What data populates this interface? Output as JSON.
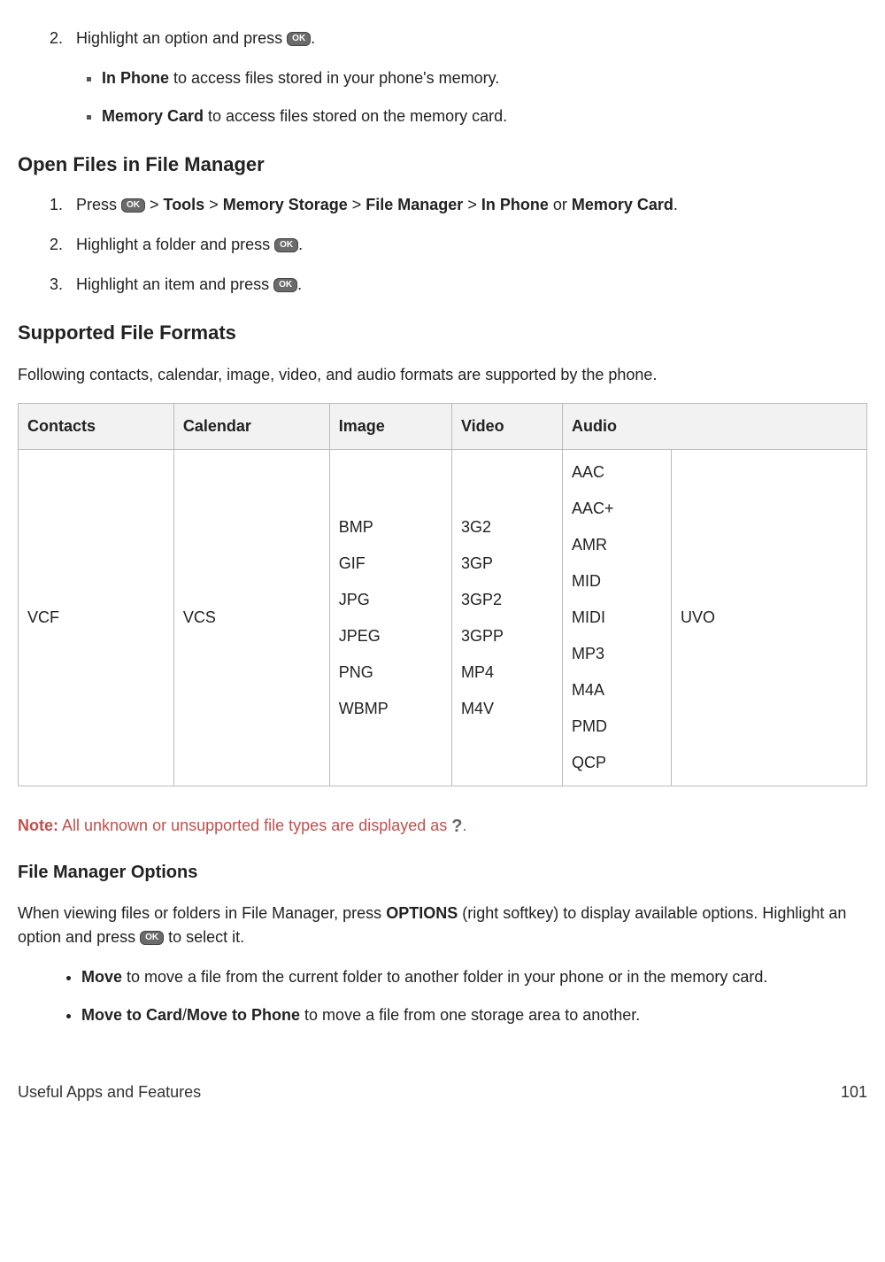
{
  "intro": {
    "step2_num": "2.",
    "step2_text_a": "Highlight an option and press ",
    "step2_text_b": ".",
    "bullets": [
      {
        "bold": "In Phone",
        "rest": " to access files stored in your phone's memory."
      },
      {
        "bold": "Memory Card",
        "rest": " to access files stored on the memory card."
      }
    ]
  },
  "open_files": {
    "heading": "Open Files in File Manager",
    "steps": [
      {
        "pre": "Press ",
        "after": " > ",
        "b1": "Tools",
        "s1": " > ",
        "b2": "Memory Storage",
        "s2": " > ",
        "b3": "File Manager",
        "s3": " > ",
        "b4": "In Phone",
        "s4": " or ",
        "b5": "Memory Card",
        "end": "."
      },
      {
        "text_a": "Highlight a folder and press ",
        "text_b": "."
      },
      {
        "text_a": "Highlight an item and press ",
        "text_b": "."
      }
    ]
  },
  "formats": {
    "heading": "Supported File Formats",
    "intro": "Following contacts, calendar, image, video, and audio formats are supported by the phone.",
    "headers": [
      "Contacts",
      "Calendar",
      "Image",
      "Video",
      "Audio"
    ],
    "contacts": [
      "VCF"
    ],
    "calendar": [
      "VCS"
    ],
    "image": [
      "BMP",
      "GIF",
      "JPG",
      "JPEG",
      "PNG",
      "WBMP"
    ],
    "video": [
      "3G2",
      "3GP",
      "3GP2",
      "3GPP",
      "MP4",
      "M4V"
    ],
    "audio1": [
      "AAC",
      "AAC+",
      "AMR",
      "MID",
      "MIDI",
      "MP3",
      "M4A",
      "PMD",
      "QCP"
    ],
    "audio2": [
      "UVO"
    ]
  },
  "note": {
    "label": "Note:",
    "text_a": "  All unknown or unsupported file types are displayed as ",
    "text_b": "."
  },
  "options": {
    "heading": "File Manager Options",
    "intro_a": "When viewing files or folders in File Manager, press ",
    "intro_bold": "OPTIONS",
    "intro_b": " (right softkey) to display available options. Highlight an option and press ",
    "intro_c": " to select it.",
    "bullets": [
      {
        "bold": "Move",
        "rest": " to move a file from the current folder to another folder in your phone or in the memory card."
      },
      {
        "bold": "Move to Card",
        "mid": "/",
        "bold2": "Move to Phone",
        "rest": " to move a file from one storage area to another."
      }
    ]
  },
  "footer": {
    "left": "Useful Apps and Features",
    "right": "101"
  },
  "icons": {
    "ok": "OK",
    "question": "?"
  }
}
